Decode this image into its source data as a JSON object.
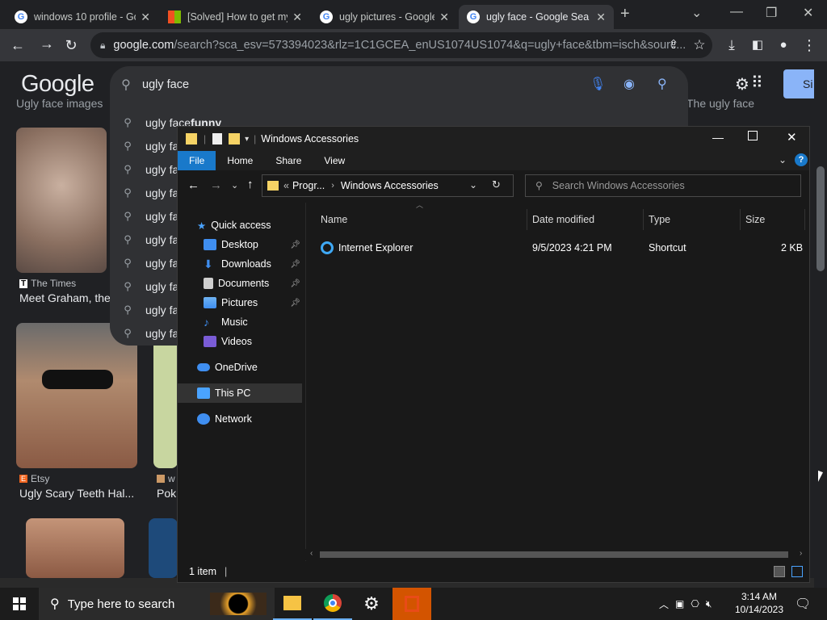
{
  "browser": {
    "tabs": [
      {
        "title": "windows 10 profile - Go",
        "favicon": "google-g",
        "active": false
      },
      {
        "title": "[Solved] How to get my",
        "favicon": "microsoft",
        "active": false
      },
      {
        "title": "ugly pictures - Google",
        "favicon": "google-g",
        "active": false
      },
      {
        "title": "ugly face - Google Sea",
        "favicon": "google-g",
        "active": true
      }
    ],
    "url_domain": "google.com",
    "url_rest": "/search?sca_esv=573394023&rlz=1C1GCEA_enUS1074US1074&q=ugly+face&tbm=isch&sourc..."
  },
  "google": {
    "logo": "Google",
    "query": "ugly face",
    "sign_in_label": "Si",
    "suggestions": [
      {
        "prefix": "ugly face",
        "bold": " funny"
      },
      {
        "prefix": "ugly fa",
        "bold": ""
      },
      {
        "prefix": "ugly fa",
        "bold": ""
      },
      {
        "prefix": "ugly fa",
        "bold": ""
      },
      {
        "prefix": "ugly fa",
        "bold": ""
      },
      {
        "prefix": "ugly fa",
        "bold": ""
      },
      {
        "prefix": "ugly fa",
        "bold": ""
      },
      {
        "prefix": "ugly fa",
        "bold": ""
      },
      {
        "prefix": "ugly fa",
        "bold": ""
      },
      {
        "prefix": "ugly fa",
        "bold": ""
      }
    ],
    "top_left_chip": "Ugly face images",
    "top_right_chip": "The ugly face",
    "results": [
      {
        "source": "The Times",
        "caption": "Meet Graham, the"
      },
      {
        "source": "Etsy",
        "caption": "Ugly Scary Teeth Hal..."
      },
      {
        "source": "w",
        "caption": "Pok"
      }
    ]
  },
  "explorer": {
    "title": "Windows Accessories",
    "ribbon_tabs": [
      "File",
      "Home",
      "Share",
      "View"
    ],
    "path_prefix": "«",
    "path_parent": "Progr...",
    "path_current": "Windows Accessories",
    "search_placeholder": "Search Windows Accessories",
    "nav": {
      "quick_access": "Quick access",
      "desktop": "Desktop",
      "downloads": "Downloads",
      "documents": "Documents",
      "pictures": "Pictures",
      "music": "Music",
      "videos": "Videos",
      "onedrive": "OneDrive",
      "this_pc": "This PC",
      "network": "Network"
    },
    "columns": [
      "Name",
      "Date modified",
      "Type",
      "Size"
    ],
    "files": [
      {
        "name": "Internet Explorer",
        "date": "9/5/2023 4:21 PM",
        "type": "Shortcut",
        "size": "2 KB"
      }
    ],
    "status": "1 item"
  },
  "taskbar": {
    "search_placeholder": "Type here to search",
    "time": "3:14 AM",
    "date": "10/14/2023"
  },
  "colors": {
    "accent": "#1979ca",
    "chrome_bg": "#202124",
    "explorer_bg": "#191919"
  }
}
